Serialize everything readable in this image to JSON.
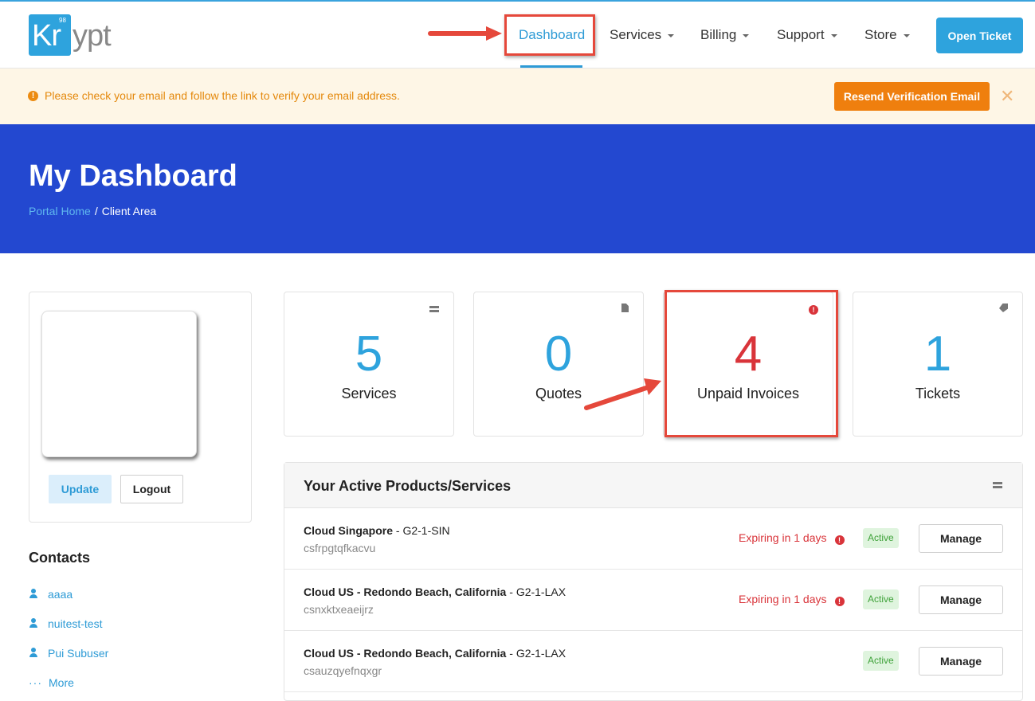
{
  "brand": {
    "logo_kr": "Kr",
    "logo_ypt": "ypt",
    "logo_badge": "98"
  },
  "nav": {
    "items": [
      {
        "label": "Dashboard",
        "active": true
      },
      {
        "label": "Services",
        "dropdown": true
      },
      {
        "label": "Billing",
        "dropdown": true
      },
      {
        "label": "Support",
        "dropdown": true
      },
      {
        "label": "Store",
        "dropdown": true
      }
    ],
    "open_ticket_label": "Open Ticket",
    "accent_color": "#2ea3dd"
  },
  "alert": {
    "message": "Please check your email and follow the link to verify your email address.",
    "resend_label": "Resend Verification Email",
    "close_symbol": "✕",
    "color": "#ef7f0e"
  },
  "hero": {
    "title": "My Dashboard",
    "breadcrumb_home": "Portal Home",
    "breadcrumb_sep": "/",
    "breadcrumb_current": "Client Area",
    "background": "#2348d0"
  },
  "profile": {
    "update_label": "Update",
    "logout_label": "Logout"
  },
  "contacts": {
    "title": "Contacts",
    "items": [
      {
        "name": "aaaa"
      },
      {
        "name": "nuitest-test"
      },
      {
        "name": "Pui Subuser"
      }
    ],
    "more_label": "More",
    "more_icon": "···"
  },
  "stats": [
    {
      "value": "5",
      "label": "Services",
      "icon": "server-icon"
    },
    {
      "value": "0",
      "label": "Quotes",
      "icon": "document-icon"
    },
    {
      "value": "4",
      "label": "Unpaid Invoices",
      "icon": "exclamation-circle-icon",
      "color": "#d9343a"
    },
    {
      "value": "1",
      "label": "Tickets",
      "icon": "tag-icon"
    }
  ],
  "products": {
    "title": "Your Active Products/Services",
    "rows": [
      {
        "product": "Cloud Singapore",
        "plan": "G2-1-SIN",
        "domain": "csfrpgtqfkacvu",
        "expiry": "Expiring in 1 days",
        "status": "Active",
        "manage_label": "Manage"
      },
      {
        "product": "Cloud US - Redondo Beach, California",
        "plan": "G2-1-LAX",
        "domain": "csnxktxeaeijrz",
        "expiry": "Expiring in 1 days",
        "status": "Active",
        "manage_label": "Manage"
      },
      {
        "product": "Cloud US - Redondo Beach, California",
        "plan": "G2-1-LAX",
        "domain": "csauzqyefnqxgr",
        "expiry": "",
        "status": "Active",
        "manage_label": "Manage"
      }
    ]
  },
  "plan_separator": " - ",
  "annotation_color": "#e5483b"
}
